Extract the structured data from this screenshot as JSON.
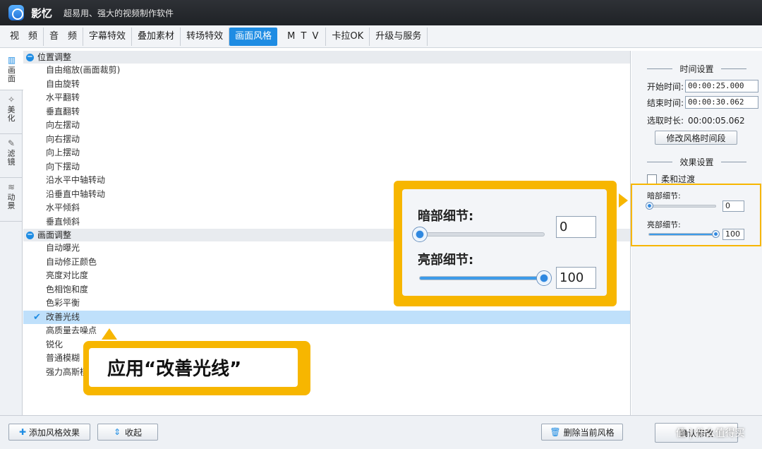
{
  "app": {
    "name": "影忆",
    "slogan": "超易用、强大的视频制作软件"
  },
  "menu": [
    "视　频",
    "音　频",
    "字幕特效",
    "叠加素材",
    "转场特效",
    "画面风格",
    "M T V",
    "卡拉OK",
    "升级与服务"
  ],
  "menu_active": "画面风格",
  "sidetabs": [
    {
      "label": "画面",
      "icon": "picture-icon"
    },
    {
      "label": "美化",
      "icon": "magic-wand-icon"
    },
    {
      "label": "滤镜",
      "icon": "filter-wand-icon"
    },
    {
      "label": "动景",
      "icon": "waves-icon"
    }
  ],
  "groups": [
    {
      "title": "位置调整",
      "items": [
        "自由缩放(画面裁剪)",
        "自由旋转",
        "水平翻转",
        "垂直翻转",
        "向左摆动",
        "向右摆动",
        "向上摆动",
        "向下摆动",
        "沿水平中轴转动",
        "沿垂直中轴转动",
        "水平倾斜",
        "垂直倾斜"
      ]
    },
    {
      "title": "画面调整",
      "items": [
        "自动曝光",
        "自动修正颜色",
        "亮度对比度",
        "色相饱和度",
        "色彩平衡",
        "改善光线",
        "高质量去噪点",
        "锐化",
        "普通模糊",
        "强力高斯模糊"
      ]
    }
  ],
  "selected_item": "改善光线",
  "time_settings": {
    "title": "时间设置",
    "start_label": "开始时间:",
    "start_value": "00:00:25.000",
    "end_label": "结束时间:",
    "end_value": "00:00:30.062",
    "duration_label": "选取时长:",
    "duration_value": "00:00:05.062",
    "modify_button": "修改风格时间段"
  },
  "effect_settings": {
    "title": "效果设置",
    "smooth_label": "柔和过渡",
    "smooth_checked": false,
    "dark_label": "暗部细节:",
    "dark_value": "0",
    "dark_fraction": 0,
    "bright_label": "亮部细节:",
    "bright_value": "100",
    "bright_fraction": 1
  },
  "bottom": {
    "add_button": "添加风格效果",
    "collapse_button": "收起",
    "delete_button": "删除当前风格",
    "confirm_button": "确认修改"
  },
  "callout_text": "应用“改善光线”",
  "watermark": "值 | 什么值得买",
  "colors": {
    "accent": "#1e8ce3",
    "highlight": "#f7b600",
    "selected_row": "#bfe0fb"
  }
}
